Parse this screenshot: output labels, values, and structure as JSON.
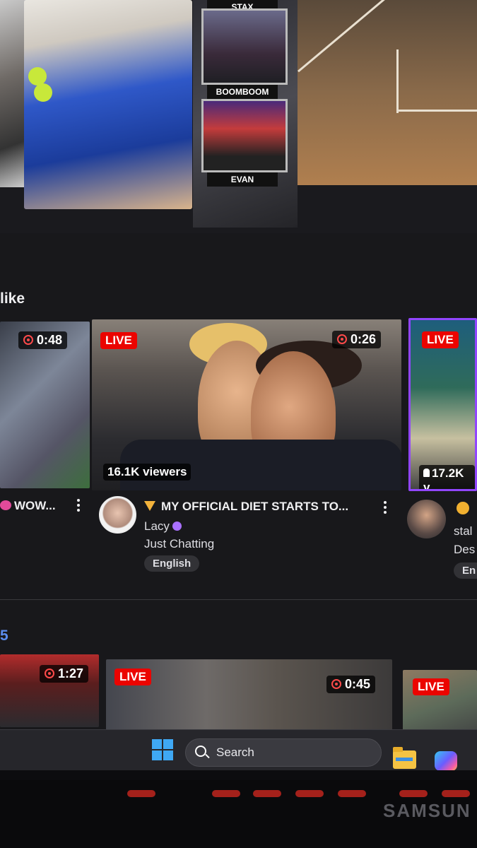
{
  "top_feature": {
    "cam_labels": [
      "STAX",
      "BOOMBOOM",
      "EVAN"
    ]
  },
  "section_like": {
    "title": "like"
  },
  "section_second": {
    "title": "5"
  },
  "row1": {
    "card_left": {
      "duration": "0:48",
      "title": "WOW..."
    },
    "card_main": {
      "live": "LIVE",
      "duration": "0:26",
      "viewers": "16.1K viewers",
      "title": "MY OFFICIAL DIET STARTS TO...",
      "channel": "Lacy",
      "category": "Just Chatting",
      "tag": "English"
    },
    "card_right": {
      "live": "LIVE",
      "viewers": "17.2K v",
      "channel_partial": "stal",
      "category_partial": "Des",
      "tag_partial": "En"
    }
  },
  "row2": {
    "card_a": {
      "duration": "1:27"
    },
    "card_b": {
      "live": "LIVE",
      "duration": "0:45"
    },
    "card_c": {
      "live": "LIVE"
    }
  },
  "taskbar": {
    "search_label": "Search"
  },
  "monitor": {
    "brand": "SAMSUN"
  },
  "colors": {
    "live_red": "#eb0400",
    "twitch_purple": "#9146ff",
    "bg": "#18181b"
  }
}
